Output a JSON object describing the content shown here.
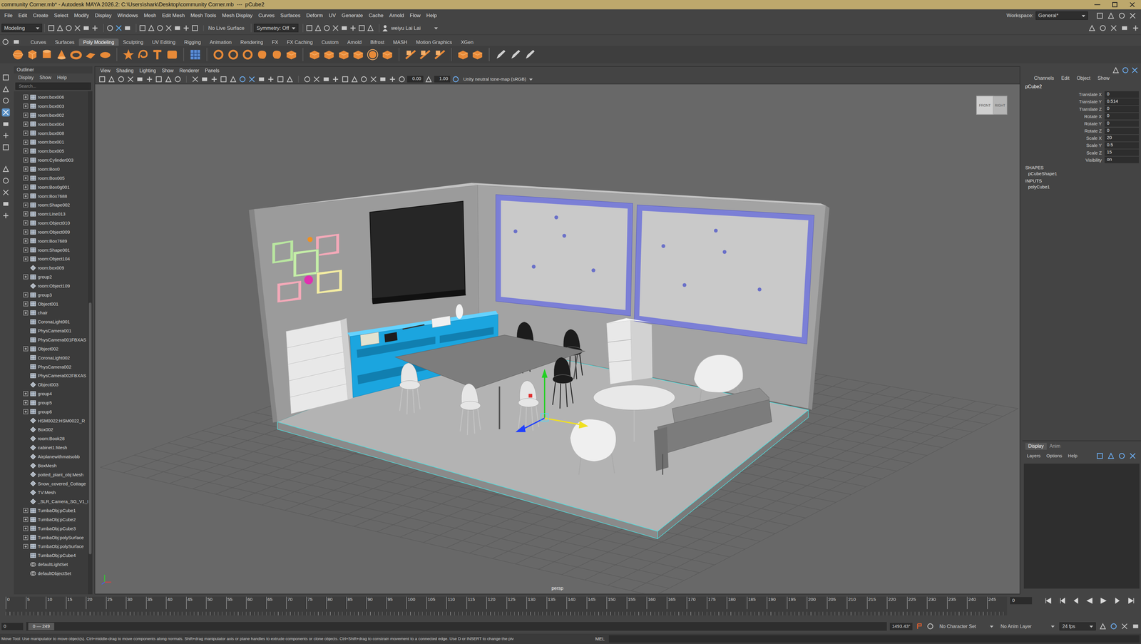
{
  "window": {
    "title": "community Corner.mb* - Autodesk MAYA 2026.2: C:\\Users\\shark\\Desktop\\community Corner.mb  ---  pCube2"
  },
  "menubar": [
    "File",
    "Edit",
    "Create",
    "Select",
    "Modify",
    "Display",
    "Windows",
    "Mesh",
    "Edit Mesh",
    "Mesh Tools",
    "Mesh Display",
    "Curves",
    "Surfaces",
    "Deform",
    "UV",
    "Generate",
    "Cache",
    "Arnold",
    "Flow",
    "Help"
  ],
  "workspace": {
    "label": "Workspace:",
    "value": "General*"
  },
  "status_line": {
    "mode": "Modeling",
    "live_surface": "No Live Surface",
    "symmetry": "Symmetry: Off",
    "user": "weiyu Lai Lai"
  },
  "shelf": {
    "tabs": [
      {
        "label": "Curves",
        "selected": false
      },
      {
        "label": "Surfaces",
        "selected": false
      },
      {
        "label": "Poly Modeling",
        "selected": true
      },
      {
        "label": "Sculpting",
        "selected": false
      },
      {
        "label": "UV Editing",
        "selected": false
      },
      {
        "label": "Rigging",
        "selected": false
      },
      {
        "label": "Animation",
        "selected": false
      },
      {
        "label": "Rendering",
        "selected": false
      },
      {
        "label": "FX",
        "selected": false
      },
      {
        "label": "FX Caching",
        "selected": false
      },
      {
        "label": "Custom",
        "selected": false
      },
      {
        "label": "Arnold",
        "selected": false
      },
      {
        "label": "Bifrost",
        "selected": false
      },
      {
        "label": "MASH",
        "selected": false
      },
      {
        "label": "Motion Graphics",
        "selected": false
      },
      {
        "label": "XGen",
        "selected": false
      }
    ]
  },
  "outliner": {
    "title": "Outliner",
    "menu": [
      "Display",
      "Show",
      "Help"
    ],
    "search_placeholder": "Search...",
    "items": [
      {
        "label": "room:box006",
        "expandable": true,
        "kind": "mesh"
      },
      {
        "label": "room:box003",
        "expandable": true,
        "kind": "mesh"
      },
      {
        "label": "room:box002",
        "expandable": true,
        "kind": "mesh"
      },
      {
        "label": "room:box004",
        "expandable": true,
        "kind": "mesh"
      },
      {
        "label": "room:box008",
        "expandable": true,
        "kind": "mesh"
      },
      {
        "label": "room:box001",
        "expandable": true,
        "kind": "mesh"
      },
      {
        "label": "room:box005",
        "expandable": true,
        "kind": "mesh"
      },
      {
        "label": "room:Cylinder003",
        "expandable": true,
        "kind": "mesh"
      },
      {
        "label": "room:Box0",
        "expandable": true,
        "kind": "mesh"
      },
      {
        "label": "room:Box005",
        "expandable": true,
        "kind": "mesh"
      },
      {
        "label": "room:Box0g001",
        "expandable": true,
        "kind": "mesh"
      },
      {
        "label": "room:Box7688",
        "expandable": true,
        "kind": "mesh"
      },
      {
        "label": "room:Shape002",
        "expandable": true,
        "kind": "mesh"
      },
      {
        "label": "room:Line013",
        "expandable": true,
        "kind": "mesh"
      },
      {
        "label": "room:Object010",
        "expandable": true,
        "kind": "mesh"
      },
      {
        "label": "room:Object009",
        "expandable": true,
        "kind": "mesh"
      },
      {
        "label": "room:Box7689",
        "expandable": true,
        "kind": "mesh"
      },
      {
        "label": "room:Shape001",
        "expandable": true,
        "kind": "mesh"
      },
      {
        "label": "room:Object104",
        "expandable": true,
        "kind": "mesh"
      },
      {
        "label": "room:box009",
        "expandable": false,
        "kind": "node"
      },
      {
        "label": "group2",
        "expandable": true,
        "kind": "mesh"
      },
      {
        "label": "room:Object109",
        "expandable": false,
        "kind": "node"
      },
      {
        "label": "group3",
        "expandable": true,
        "kind": "mesh"
      },
      {
        "label": "Object001",
        "expandable": true,
        "kind": "mesh"
      },
      {
        "label": "chair",
        "expandable": true,
        "kind": "mesh"
      },
      {
        "label": "CoronaLight001",
        "expandable": false,
        "kind": "mesh"
      },
      {
        "label": "PhysCamera001",
        "expandable": false,
        "kind": "mesh"
      },
      {
        "label": "PhysCamera001FBXAS",
        "expandable": false,
        "kind": "mesh"
      },
      {
        "label": "Object002",
        "expandable": true,
        "kind": "mesh"
      },
      {
        "label": "CoronaLight002",
        "expandable": false,
        "kind": "mesh"
      },
      {
        "label": "PhysCamera002",
        "expandable": false,
        "kind": "mesh"
      },
      {
        "label": "PhysCamera002FBXAS",
        "expandable": false,
        "kind": "mesh"
      },
      {
        "label": "Object003",
        "expandable": false,
        "kind": "node"
      },
      {
        "label": "group4",
        "expandable": true,
        "kind": "mesh"
      },
      {
        "label": "group5",
        "expandable": true,
        "kind": "mesh"
      },
      {
        "label": "group6",
        "expandable": true,
        "kind": "mesh"
      },
      {
        "label": "HSM0022:HSM0022_R",
        "expandable": false,
        "kind": "node"
      },
      {
        "label": "Box002",
        "expandable": false,
        "kind": "node"
      },
      {
        "label": "room:Book28",
        "expandable": false,
        "kind": "node"
      },
      {
        "label": "cabinet1:Mesh",
        "expandable": false,
        "kind": "node"
      },
      {
        "label": "Airplanewithmatsobb",
        "expandable": false,
        "kind": "node"
      },
      {
        "label": "BoxMesh",
        "expandable": false,
        "kind": "node"
      },
      {
        "label": "potted_plant_obj:Mesh",
        "expandable": false,
        "kind": "node"
      },
      {
        "label": "Snow_covered_Cottage",
        "expandable": false,
        "kind": "node"
      },
      {
        "label": "TV:Mesh",
        "expandable": false,
        "kind": "node"
      },
      {
        "label": "_SLR_Camera_SG_V1_I",
        "expandable": false,
        "kind": "node"
      },
      {
        "label": "TumbaObj:pCube1",
        "expandable": true,
        "kind": "mesh"
      },
      {
        "label": "TumbaObj:pCube2",
        "expandable": true,
        "kind": "mesh"
      },
      {
        "label": "TumbaObj:pCube3",
        "expandable": true,
        "kind": "mesh"
      },
      {
        "label": "TumbaObj:polySurface",
        "expandable": true,
        "kind": "mesh"
      },
      {
        "label": "TumbaObj:polySurface",
        "expandable": true,
        "kind": "mesh"
      },
      {
        "label": "TumbaObj:pCube4",
        "expandable": false,
        "kind": "mesh"
      },
      {
        "label": "defaultLightSet",
        "expandable": false,
        "kind": "set"
      },
      {
        "label": "defaultObjectSet",
        "expandable": false,
        "kind": "set"
      }
    ]
  },
  "viewport": {
    "menu": [
      "View",
      "Shading",
      "Lighting",
      "Show",
      "Renderer",
      "Panels"
    ],
    "exposure": "0.00",
    "gamma": "1.00",
    "colorspace": "Unity neutral tone-map (sRGB)",
    "camera": "persp",
    "view_cube": [
      "FRONT",
      "RIGHT"
    ]
  },
  "channel_box": {
    "tabs": [
      "Channels",
      "Edit",
      "Object",
      "Show"
    ],
    "node": "pCube2",
    "attributes": [
      {
        "name": "Translate X",
        "value": "0"
      },
      {
        "name": "Translate Y",
        "value": "0.514"
      },
      {
        "name": "Translate Z",
        "value": "0"
      },
      {
        "name": "Rotate X",
        "value": "0"
      },
      {
        "name": "Rotate Y",
        "value": "0"
      },
      {
        "name": "Rotate Z",
        "value": "0"
      },
      {
        "name": "Scale X",
        "value": "20"
      },
      {
        "name": "Scale Y",
        "value": "0.5"
      },
      {
        "name": "Scale Z",
        "value": "15"
      },
      {
        "name": "Visibility",
        "value": "on"
      }
    ],
    "shapes_header": "SHAPES",
    "shapes": [
      "pCubeShape1"
    ],
    "inputs_header": "INPUTS",
    "inputs": [
      "polyCube1"
    ]
  },
  "layer_editor": {
    "tabs": [
      {
        "label": "Display",
        "selected": true
      },
      {
        "label": "Anim",
        "selected": false
      }
    ],
    "menu": [
      "Layers",
      "Options",
      "Help"
    ]
  },
  "timeline": {
    "ticks": [
      "0",
      "5",
      "10",
      "15",
      "20",
      "25",
      "30",
      "35",
      "40",
      "45",
      "50",
      "55",
      "60",
      "65",
      "70",
      "75",
      "80",
      "85",
      "90",
      "95",
      "100",
      "105",
      "110",
      "115",
      "120",
      "125",
      "130",
      "135",
      "140",
      "145",
      "150",
      "155",
      "160",
      "165",
      "170",
      "175",
      "180",
      "185",
      "190",
      "195",
      "200",
      "205",
      "210",
      "215",
      "220",
      "225",
      "230",
      "235",
      "240",
      "245"
    ],
    "current_frame": "0"
  },
  "range": {
    "start": "0",
    "handle": "0 — 249",
    "end": "1493.43°",
    "character_set": "No Character Set",
    "anim_layer": "No Anim Layer",
    "fps": "24 fps"
  },
  "help_line": "Move Tool: Use manipulator to move object(s). Ctrl+middle-drag to move components along normals. Shift+drag manipulator axis or plane handles to extrude components or clone objects. Ctrl+Shift+drag to constrain movement to a connected edge. Use D or INSERT to change the piv",
  "command_language": "MEL"
}
